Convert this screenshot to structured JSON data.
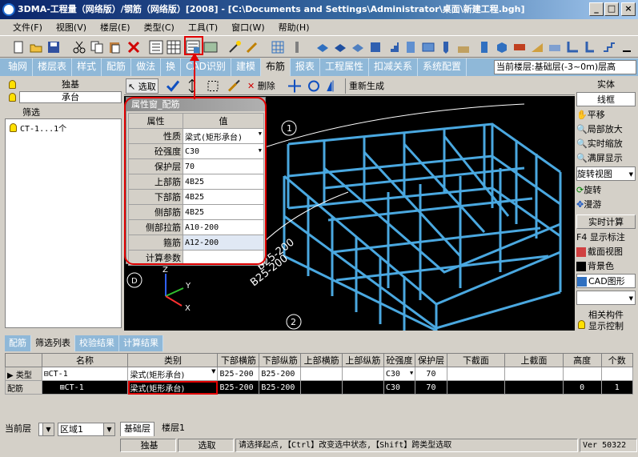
{
  "window": {
    "title": "3DMA-工程量（网络版）/钢筋（网络版）[2008] - [C:\\Documents and Settings\\Administrator\\桌面\\新建工程.bgh]"
  },
  "menu": [
    "文件(F)",
    "视图(V)",
    "楼层(E)",
    "类型(C)",
    "工具(T)",
    "窗口(W)",
    "帮助(H)"
  ],
  "tabs": [
    "轴网",
    "楼层表",
    "样式",
    "配筋",
    "做法",
    "换",
    "CAD识别",
    "建模",
    "布筋",
    "报表",
    "工程属性",
    "扣减关系",
    "系统配置"
  ],
  "active_tab": "布筋",
  "current_floor": "当前楼层:基础层(-3~0m)层高",
  "left_panel": {
    "header": "独基",
    "type_field": "承台",
    "filter_label": "筛选",
    "filter_item": "CT-1...1个"
  },
  "select_toolbar": {
    "select": "选取",
    "delete": "删除",
    "regen": "重新生成"
  },
  "prop_window": {
    "title": "属性窗_配筋",
    "col_attr": "属性",
    "col_val": "值",
    "rows": [
      {
        "k": "性质",
        "v": "梁式(矩形承台)"
      },
      {
        "k": "砼强度",
        "v": "C30"
      },
      {
        "k": "保护层",
        "v": "70"
      },
      {
        "k": "上部筋",
        "v": "4B25"
      },
      {
        "k": "下部筋",
        "v": "4B25"
      },
      {
        "k": "侧部筋",
        "v": "4B25"
      },
      {
        "k": "侧部拉筋",
        "v": "A10-200"
      },
      {
        "k": "箍筋",
        "v": "A12-200"
      },
      {
        "k": "计算参数",
        "v": ""
      }
    ]
  },
  "viewport": {
    "dim1": "B25-200",
    "dim2": "B25-200",
    "axis1": "1",
    "axis2": "2",
    "axisD": "D",
    "z": "Z",
    "y": "Y",
    "x": "X"
  },
  "right_panel": {
    "header": "实体",
    "wire": "线框",
    "pan": "平移",
    "zoom_local": "局部放大",
    "zoom_rt": "实时缩放",
    "full": "满屏显示",
    "rotate_view": "旋转视图",
    "rotate": "旋转",
    "roam": "漫游",
    "realtime_calc": "实时计算",
    "f4": "F4 显示标注",
    "section": "截面视图",
    "bg": "背景色",
    "cad": "CAD图形",
    "related": "相关构件",
    "display_ctrl": "显示控制"
  },
  "bottom": {
    "tabs": [
      "配筋",
      "筛选列表",
      "校验结果",
      "计算结果"
    ],
    "active_tab": "筛选列表",
    "columns": [
      "名称",
      "类别",
      "下部横筋",
      "下部纵筋",
      "上部横筋",
      "上部纵筋",
      "砼强度",
      "保护层",
      "下截面",
      "上截面",
      "高度",
      "个数"
    ],
    "rows": [
      {
        "rowhead": "类型",
        "name": "⊟CT-1",
        "cat": "梁式(矩形承台)",
        "c1": "B25-200",
        "c2": "B25-200",
        "c3": "",
        "c4": "",
        "c5": "C30",
        "c6": "70",
        "c7": "",
        "c8": "",
        "c9": "",
        "c10": ""
      },
      {
        "rowhead": "配筋",
        "name": "⊞CT-1",
        "cat": "梁式(矩形承台)",
        "c1": "B25-200",
        "c2": "B25-200",
        "c3": "",
        "c4": "",
        "c5": "C30",
        "c6": "70",
        "c7": "",
        "c8": "",
        "c9": "0",
        "c10": "1"
      }
    ]
  },
  "status": {
    "current_floor": "当前层",
    "zone": "区域1",
    "floor_tab1": "基础层",
    "floor_tab2": "楼层1",
    "type": "独基",
    "mode": "选取",
    "hint": "请选择起点,【Ctrl】改变选中状态,【Shift】跨类型选取",
    "version": "Ver 50322"
  }
}
